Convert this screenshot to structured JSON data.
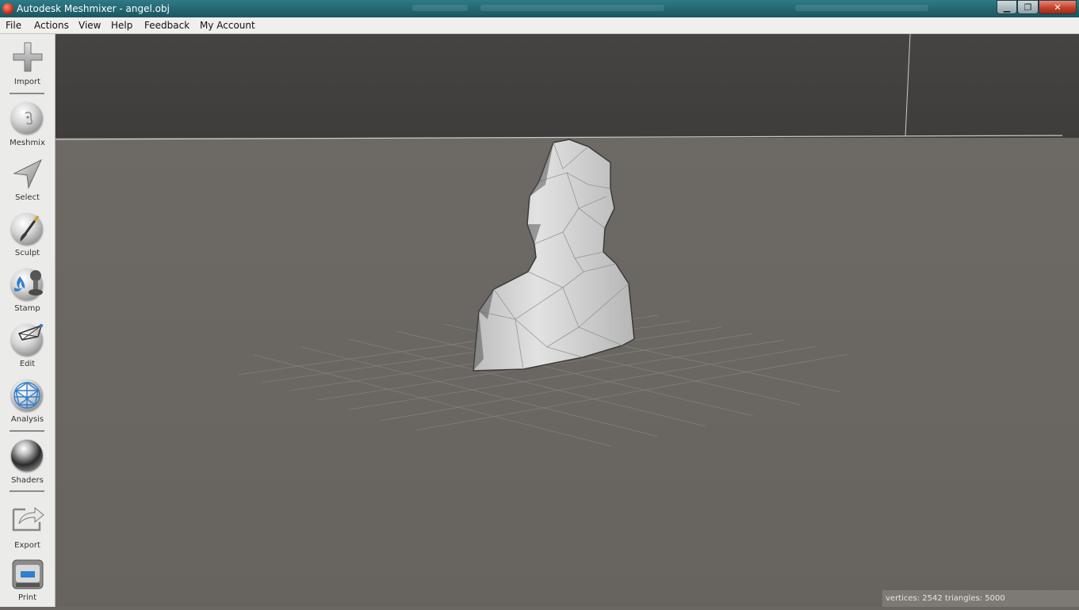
{
  "window": {
    "title": "Autodesk Meshmixer - angel.obj",
    "minimize_glyph": "▁",
    "maximize_glyph": "❐",
    "close_glyph": "✕"
  },
  "menu": [
    "File",
    "Actions",
    "View",
    "Help",
    "Feedback",
    "My Account"
  ],
  "tools": [
    {
      "label": "Import",
      "icon": "plus-icon"
    },
    {
      "label": "Meshmix",
      "icon": "meshmix-sphere-icon"
    },
    {
      "label": "Select",
      "icon": "arrow-cursor-icon"
    },
    {
      "label": "Sculpt",
      "icon": "brush-sphere-icon"
    },
    {
      "label": "Stamp",
      "icon": "stamp-sphere-icon"
    },
    {
      "label": "Edit",
      "icon": "edit-sphere-icon"
    },
    {
      "label": "Analysis",
      "icon": "analysis-sphere-icon"
    },
    {
      "label": "Shaders",
      "icon": "shader-sphere-icon"
    },
    {
      "label": "Export",
      "icon": "export-icon"
    },
    {
      "label": "Print",
      "icon": "printer-icon"
    }
  ],
  "status": {
    "text": "vertices: 2542 triangles: 5000"
  },
  "colors": {
    "titlebar": "#21646f",
    "viewport_floor": "#6a6662",
    "viewport_backwall": "#454341",
    "accent_blue": "#2f7fd0"
  }
}
